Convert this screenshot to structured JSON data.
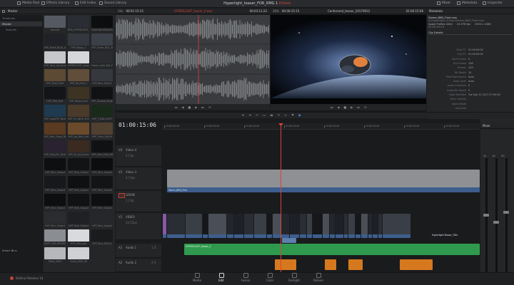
{
  "colors": {
    "video_clip": "#3d5e8c",
    "video_clip_light": "#5c7fae",
    "audio_clip": "#2f9a4d",
    "audio_clip_orange": "#d6791e",
    "gray_clip": "#8e9093",
    "playhead": "#d8433a",
    "marker_pink": "#c84fd6",
    "marker_blue": "#3e8ee6",
    "accent_red": "#c8433c"
  },
  "topbar": {
    "left_items": [
      {
        "icon": "media-pool-icon",
        "label": "Media Pool"
      },
      {
        "icon": "effects-library-icon",
        "label": "Effects Library"
      },
      {
        "icon": "edit-index-icon",
        "label": "Edit Index"
      },
      {
        "icon": "sound-library-icon",
        "label": "Sound Library"
      }
    ],
    "project_title": "Hyperlight_teaser_FOR_RMG 1",
    "project_status": "Edited",
    "right_items": [
      {
        "icon": "mixer-icon",
        "label": "Mixer"
      },
      {
        "icon": "metadata-icon",
        "label": "Metadata"
      },
      {
        "icon": "inspector-icon",
        "label": "Inspector"
      }
    ]
  },
  "media_pool": {
    "header": "Master",
    "bins": [
      "Timelines",
      "Master",
      "Sources"
    ],
    "smart_bins_label": "Smart Bins",
    "thumbs": [
      {
        "label": "Sources",
        "color": "#555a62"
      },
      {
        "label": "BDR_HYPERLIGHT_BASI",
        "color": "#2a2d33"
      },
      {
        "label": "HyperlightDeepSlow",
        "color": "#0d0e10"
      },
      {
        "label": "HYP_FirstE_BLUE_Dur",
        "color": "#202227"
      },
      {
        "label": "HYP_Poppy_1",
        "color": "#34373d"
      },
      {
        "label": "HYP_Trailer_BLK_Shot",
        "color": "#3c4048"
      },
      {
        "label": "HYP_Shot_Vid_Shot",
        "color": "#c5c7ca"
      },
      {
        "label": "HYPERLIGHT_teaser",
        "color": "#d4d6d9"
      },
      {
        "label": "Hyper_Light_BLK_F",
        "color": "#2a2c30"
      },
      {
        "label": "HYP_Shot_Tiled",
        "color": "#5c4a34"
      },
      {
        "label": "HYP_Jet_Face_1",
        "color": "#604d3a"
      },
      {
        "label": "HYP_Blue_Shot_E",
        "color": "#35383d"
      },
      {
        "label": "HYP_Title_Hurt",
        "color": "#141518"
      },
      {
        "label": "HYP_Yellow_Hurt",
        "color": "#3d3322"
      },
      {
        "label": "HYP_Shadow_Bright",
        "color": "#111214"
      },
      {
        "label": "HYP_LogoTYP_Blue",
        "color": "#1f3a4f"
      },
      {
        "label": "HYP_FS_WIDE_SHOT",
        "color": "#4a3a2a"
      },
      {
        "label": "HYP_T_BAR_SHOT",
        "color": "#1a2a1a"
      },
      {
        "label": "HYP_Yelly_Flood_RE",
        "color": "#5a3a20"
      },
      {
        "label": "HYP_Jet_Shift_Left",
        "color": "#6a4a2a"
      },
      {
        "label": "HYP_Track_Vid_Ph",
        "color": "#504030"
      },
      {
        "label": "HYP_Ship_Pur_Shot",
        "color": "#2a2230"
      },
      {
        "label": "HYP_Vs_Jet_Frame",
        "color": "#3a2a20"
      },
      {
        "label": "HYP_Vent_Shot_AB",
        "color": "#101113"
      },
      {
        "label": "HYP_Tech_Output",
        "color": "#0e0f11"
      },
      {
        "label": "HYP_Tech_Output",
        "color": "#121315"
      },
      {
        "label": "HYP_Tech_Output",
        "color": "#0c0d0f"
      },
      {
        "label": "HYP_Tech_Output",
        "color": "#17181b"
      },
      {
        "label": "HYP_Tech_Output",
        "color": "#0f1012"
      },
      {
        "label": "HYP_Tech_Output",
        "color": "#131416"
      },
      {
        "label": "HYP_Tech_Output",
        "color": "#0d0e10"
      },
      {
        "label": "HYP_Tech_Output",
        "color": "#111214"
      },
      {
        "label": "HYP_Tech_Output",
        "color": "#0e0f11"
      },
      {
        "label": "HYP_Tech_Output",
        "color": "#2a2c30"
      },
      {
        "label": "HYP_Tech_Output",
        "color": "#1e2024"
      },
      {
        "label": "HYP_Tech_Output",
        "color": "#25272b"
      },
      {
        "label": "SHOT_003_PEOPLE",
        "color": "#8a8d91"
      },
      {
        "label": "HYP_LRes_Jets",
        "color": "#d8dadd"
      },
      {
        "label": "HYP_Star_Shot_A",
        "color": "#1a1b1d"
      },
      {
        "label": "Silent_2000",
        "color": "#b5b7ba"
      },
      {
        "label": "Cube_2000_08",
        "color": "#cfd1d4"
      }
    ]
  },
  "source_viewer": {
    "zoom": "16x",
    "timecode_left": "00:01:15:15",
    "clip_name": "HYPERLIGHT_teaser_4.wav",
    "duration": "00:03:11:22"
  },
  "timeline_viewer": {
    "zoom": "38%",
    "timecode_left": "00:00:15:15",
    "timeline_name": "Conformed_teaser_20170912",
    "timecode_right": "01:00:15:06"
  },
  "metadata": {
    "title": "Metadata",
    "file_name": "Stereo_BKD_Final.mov",
    "file_path": "D:\\Hyperlight_Trailer\\Stereo_BKD_Final.mov",
    "codec": "Apple ProRes 4444",
    "fps": "23.976 fps",
    "resolution": "1920 x 1080",
    "duration": "00:00:05:09",
    "section": "Clip Details",
    "rows": [
      {
        "k": "Start TC",
        "v": "01:00:00:00"
      },
      {
        "k": "End TC",
        "v": "01:00:05:09"
      },
      {
        "k": "Start Frame",
        "v": "0"
      },
      {
        "k": "End Frame",
        "v": "128"
      },
      {
        "k": "Frames",
        "v": "129"
      },
      {
        "k": "Bit Depth",
        "v": "10"
      },
      {
        "k": "Field Dominance",
        "v": "Auto"
      },
      {
        "k": "Data Level",
        "v": "Auto"
      },
      {
        "k": "Audio Channels",
        "v": "0"
      },
      {
        "k": "Audio Bit Depth",
        "v": "0"
      },
      {
        "k": "Date Modified",
        "v": "Tue Sep 12 2017 07:00:56"
      },
      {
        "k": "Date Created",
        "v": ""
      },
      {
        "k": "Alpha Mode",
        "v": ""
      },
      {
        "k": "KeyCode",
        "v": ""
      }
    ]
  },
  "timeline": {
    "timecode": "01:00:15:06",
    "ruler_labels": [
      "01:00:00:00",
      "01:00:05:00",
      "01:00:10:00",
      "01:00:15:00",
      "01:00:20:00",
      "01:00:25:00",
      "01:00:30:00",
      "01:00:35:00"
    ],
    "tracks": [
      {
        "id": "V4",
        "name": "Video 4",
        "sub": "0 Clip"
      },
      {
        "id": "V3",
        "name": "Video 3",
        "sub": "4 Clips"
      },
      {
        "id": "V2",
        "name": "GRAIN",
        "sub": "1 Clip"
      },
      {
        "id": "V1",
        "name": "VIDEO",
        "sub": "34 Clips"
      },
      {
        "id": "A1",
        "name": "Audio 1",
        "sub": "1.0"
      },
      {
        "id": "A2",
        "name": "Audio 2",
        "sub": "2.0"
      }
    ],
    "v3_clip_label": "Storm_BKD_Fina",
    "v2_clip_label": "Storm_BKD_Fina",
    "v1_end_label": "Hyperlight-Teaser_Title",
    "a1_clip_label": "HYPERLIGHT_teaser_4"
  },
  "mixer": {
    "title": "Mixer",
    "channels": [
      "A1",
      "A2",
      "M1"
    ],
    "labels": [
      "Audio 1",
      "Audio 2",
      "Main 1"
    ]
  },
  "pages": [
    {
      "icon": "media-page-icon",
      "label": "Media"
    },
    {
      "icon": "edit-page-icon",
      "label": "Edit",
      "active": true
    },
    {
      "icon": "fusion-page-icon",
      "label": "Fusion"
    },
    {
      "icon": "color-page-icon",
      "label": "Color"
    },
    {
      "icon": "fairlight-page-icon",
      "label": "Fairlight"
    },
    {
      "icon": "deliver-page-icon",
      "label": "Deliver"
    }
  ],
  "app_name": "DaVinci Resolve 14"
}
